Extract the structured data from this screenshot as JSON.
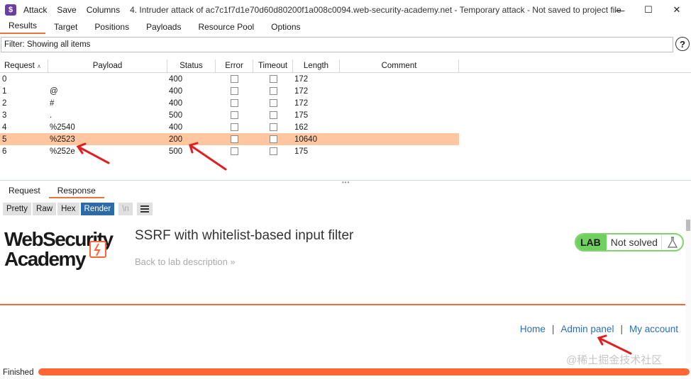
{
  "titlebar": {
    "app_icon_glyph": "$",
    "menu": [
      "Attack",
      "Save",
      "Columns"
    ],
    "window_title": "4. Intruder attack of ac7c1f7d1e70d60d80200f1a008c0094.web-security-academy.net - Temporary attack - Not saved to project file",
    "controls": {
      "minimize": "—",
      "maximize": "☐",
      "close": "✕"
    }
  },
  "tabs": [
    "Results",
    "Target",
    "Positions",
    "Payloads",
    "Resource Pool",
    "Options"
  ],
  "filter": {
    "text": "Filter: Showing all items",
    "help": "?"
  },
  "table": {
    "columns": [
      "Request",
      "Payload",
      "Status",
      "Error",
      "Timeout",
      "Length",
      "Comment"
    ],
    "sort_icon": "chevron-up-icon",
    "rows": [
      {
        "request": "0",
        "payload": "",
        "status": "400",
        "length": "172"
      },
      {
        "request": "1",
        "payload": "@",
        "status": "400",
        "length": "172"
      },
      {
        "request": "2",
        "payload": "#",
        "status": "400",
        "length": "172"
      },
      {
        "request": "3",
        "payload": ".",
        "status": "500",
        "length": "175"
      },
      {
        "request": "4",
        "payload": "%2540",
        "status": "400",
        "length": "162"
      },
      {
        "request": "5",
        "payload": "%2523",
        "status": "200",
        "length": "10640",
        "selected": true
      },
      {
        "request": "6",
        "payload": "%252e",
        "status": "500",
        "length": "175"
      }
    ],
    "selected_color": "#ffc6a0"
  },
  "split_handle": "•••",
  "message_tabs": [
    "Request",
    "Response"
  ],
  "view_buttons": {
    "pretty": "Pretty",
    "raw": "Raw",
    "hex": "Hex",
    "render": "Render",
    "newline": "\\n"
  },
  "render": {
    "logo_line1": "WebSecurity",
    "logo_line2": "Academy",
    "lab_title": "SSRF with whitelist-based input filter",
    "back_link": "Back to lab description »",
    "lab_badge": "LAB",
    "lab_status": "Not solved",
    "flask_icon": "flask-icon",
    "nav": {
      "home": "Home",
      "sep": "|",
      "admin": "Admin panel",
      "account": "My account"
    },
    "accent": "#ff6633"
  },
  "status": {
    "label": "Finished",
    "progress": 1.0
  },
  "watermark": "@稀土掘金技术社区"
}
